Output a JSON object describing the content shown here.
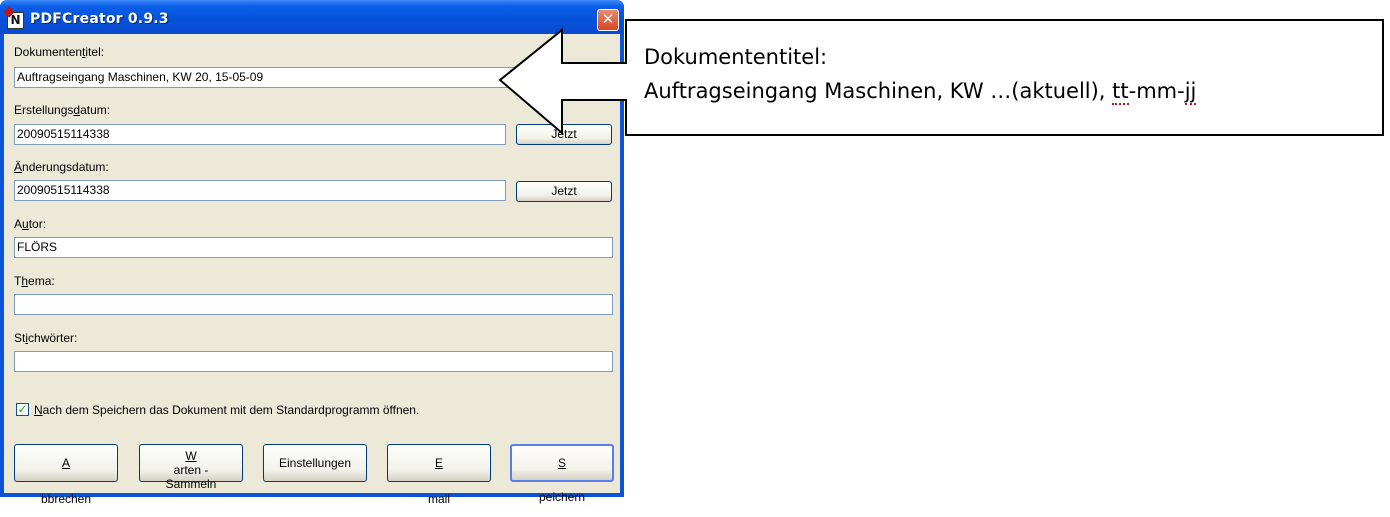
{
  "window": {
    "title": "PDFCreator 0.9.3",
    "close_symbol": "✕",
    "app_icon_glyph": "N"
  },
  "form": {
    "doc_title": {
      "label_pre": "Dokumenten",
      "label_u": "t",
      "label_post": "itel:",
      "value": "Auftragseingang Maschinen, KW 20, 15-05-09"
    },
    "created": {
      "label_pre": "Erstellungs",
      "label_u": "d",
      "label_post": "atum:",
      "value": "20090515114338",
      "button": "Jetzt"
    },
    "modified": {
      "label_pre": "",
      "label_u": "Ä",
      "label_post": "nderungsdatum:",
      "value": "20090515114338",
      "button": "Jetzt"
    },
    "author": {
      "label_pre": "A",
      "label_u": "u",
      "label_post": "tor:",
      "value": "FLÖRS"
    },
    "subject": {
      "label_pre": "T",
      "label_u": "h",
      "label_post": "ema:",
      "value": ""
    },
    "keywords": {
      "label_pre": "St",
      "label_u": "i",
      "label_post": "chwörter:",
      "value": ""
    }
  },
  "open_after_save": {
    "checked": true,
    "check_glyph": "✓",
    "label_u": "N",
    "label_rest": "ach dem Speichern das Dokument mit dem Standardprogramm öffnen."
  },
  "buttons": {
    "cancel": {
      "u": "A",
      "rest": "bbrechen"
    },
    "wait_line1": {
      "u": "W",
      "rest": "arten -"
    },
    "wait_line2": "Sammeln",
    "settings": "Einstellungen",
    "email": {
      "u": "E",
      "rest": "mail"
    },
    "save": {
      "u": "S",
      "rest": "peichern"
    }
  },
  "callout": {
    "line1": "Dokumententitel:",
    "line2_main": "Auftragseingang Maschinen, KW …(aktuell), ",
    "line2_a": "tt",
    "line2_b": "-mm-",
    "line2_c": "jj"
  },
  "colors": {
    "titlebar": "#0550d8",
    "dialog_bg": "#ece9d8",
    "field_border": "#7f9db9",
    "checkmark": "#21a121"
  }
}
